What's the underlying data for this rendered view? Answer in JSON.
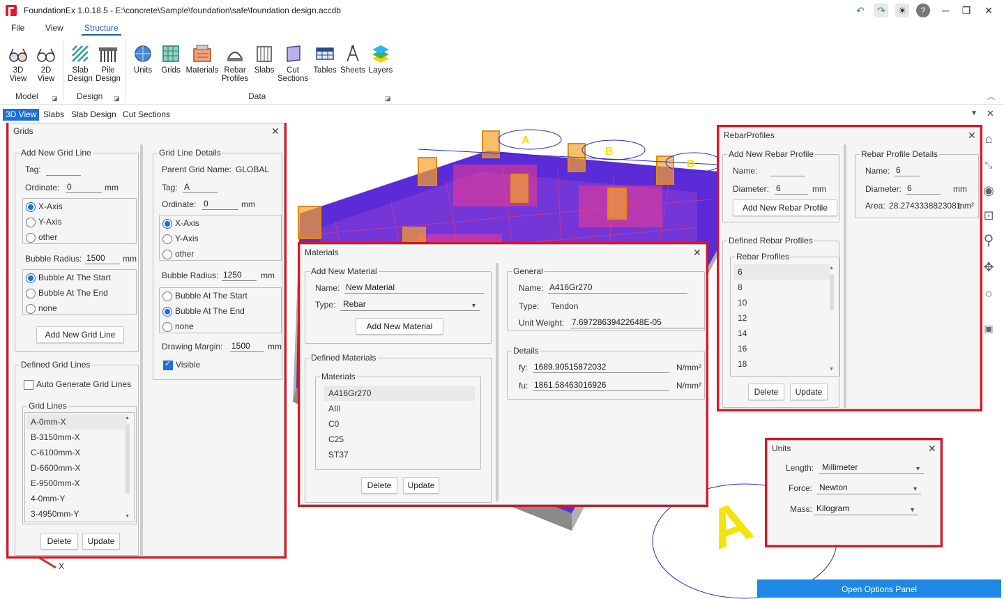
{
  "window": {
    "title": "FoundationEx 1.0.18.5 - E:\\concrete\\Sample\\foundation\\safe\\foundation design.accdb"
  },
  "menu": {
    "file": "File",
    "view": "View",
    "structure": "Structure"
  },
  "ribbon": {
    "model": {
      "view3d": "3D\nView",
      "view2d": "2D\nView",
      "group": "Model"
    },
    "design": {
      "slab": "Slab\nDesign",
      "pile": "Pile\nDesign",
      "group": "Design"
    },
    "data": {
      "units": "Units",
      "grids": "Grids",
      "materials": "Materials",
      "rebar": "Rebar\nProfiles",
      "slabs": "Slabs",
      "cut": "Cut\nSections",
      "tables": "Tables",
      "sheets": "Sheets",
      "layers": "Layers",
      "group": "Data"
    }
  },
  "tabs": [
    "3D View",
    "Slabs",
    "Slab Design",
    "Cut Sections"
  ],
  "scene": {
    "bubbles": [
      "A",
      "B",
      "D"
    ],
    "big_label": "A",
    "axis": "X"
  },
  "grids": {
    "title": "Grids",
    "add": {
      "legend": "Add New Grid Line",
      "tag_label": "Tag:",
      "tag": "",
      "ordinate_label": "Ordinate:",
      "ordinate": "0",
      "unit": "mm",
      "axis_opts": [
        "X-Axis",
        "Y-Axis",
        "other"
      ],
      "radius_label": "Bubble Radius:",
      "radius": "1500",
      "bubble_opts": [
        "Bubble At The Start",
        "Bubble At The End",
        "none"
      ],
      "add_btn": "Add New Grid Line"
    },
    "defined": {
      "legend": "Defined Grid Lines",
      "auto": "Auto Generate Grid Lines",
      "list_legend": "Grid Lines",
      "items": [
        "A-0mm-X",
        "B-3150mm-X",
        "C-6100mm-X",
        "D-6600mm-X",
        "E-9500mm-X",
        "4-0mm-Y",
        "3-4950mm-Y"
      ],
      "delete": "Delete",
      "update": "Update"
    },
    "details": {
      "legend": "Grid Line Details",
      "parent_label": "Parent Grid Name:",
      "parent": "GLOBAL",
      "tag_label": "Tag:",
      "tag": "A",
      "ordinate_label": "Ordinate:",
      "ordinate": "0",
      "unit": "mm",
      "axis_opts": [
        "X-Axis",
        "Y-Axis",
        "other"
      ],
      "radius_label": "Bubble Radius:",
      "radius": "1250",
      "bubble_opts": [
        "Bubble At The Start",
        "Bubble At The End",
        "none"
      ],
      "margin_label": "Drawing Margin:",
      "margin": "1500",
      "visible": "Visible"
    }
  },
  "materials": {
    "title": "Materials",
    "add": {
      "legend": "Add New Material",
      "name_label": "Name:",
      "name": "New Material",
      "type_label": "Type:",
      "type": "Rebar",
      "add_btn": "Add New Material"
    },
    "defined": {
      "legend": "Defined Materials",
      "list_legend": "Materials",
      "items": [
        "A416Gr270",
        "AIII",
        "C0",
        "C25",
        "ST37"
      ],
      "delete": "Delete",
      "update": "Update"
    },
    "general": {
      "legend": "General",
      "name_label": "Name:",
      "name": "A416Gr270",
      "type_label": "Type:",
      "type": "Tendon",
      "uw_label": "Unit Weight:",
      "uw": "7.69728639422648E-05"
    },
    "details": {
      "legend": "Details",
      "fy_label": "fy:",
      "fy": "1689.90515872032",
      "fu_label": "fu:",
      "fu": "1861.58463016926",
      "unit": "N/mm²"
    }
  },
  "rebar": {
    "title": "RebarProfiles",
    "add": {
      "legend": "Add New Rebar Profile",
      "name_label": "Name:",
      "name": "",
      "dia_label": "Diameter:",
      "dia": "6",
      "unit": "mm",
      "add_btn": "Add New Rebar Profile"
    },
    "defined": {
      "legend": "Defined Rebar Profiles",
      "list_legend": "Rebar Profiles",
      "items": [
        "6",
        "8",
        "10",
        "12",
        "14",
        "16",
        "18"
      ],
      "delete": "Delete",
      "update": "Update"
    },
    "details": {
      "legend": "Rebar Profile Details",
      "name_label": "Name:",
      "name": "6",
      "dia_label": "Diameter:",
      "dia": "6",
      "unit": "mm",
      "area_label": "Area:",
      "area": "28.2743338823081",
      "area_unit": "mm²"
    }
  },
  "units": {
    "title": "Units",
    "length_label": "Length:",
    "length": "Millimeter",
    "force_label": "Force:",
    "force": "Newton",
    "mass_label": "Mass:",
    "mass": "Kilogram"
  },
  "options_btn": "Open Options Panel",
  "colors": {
    "highlight": "#e3111f",
    "accent": "#1e6fd9",
    "slab": "#5a2bd6",
    "bubble": "#f4e20b"
  }
}
